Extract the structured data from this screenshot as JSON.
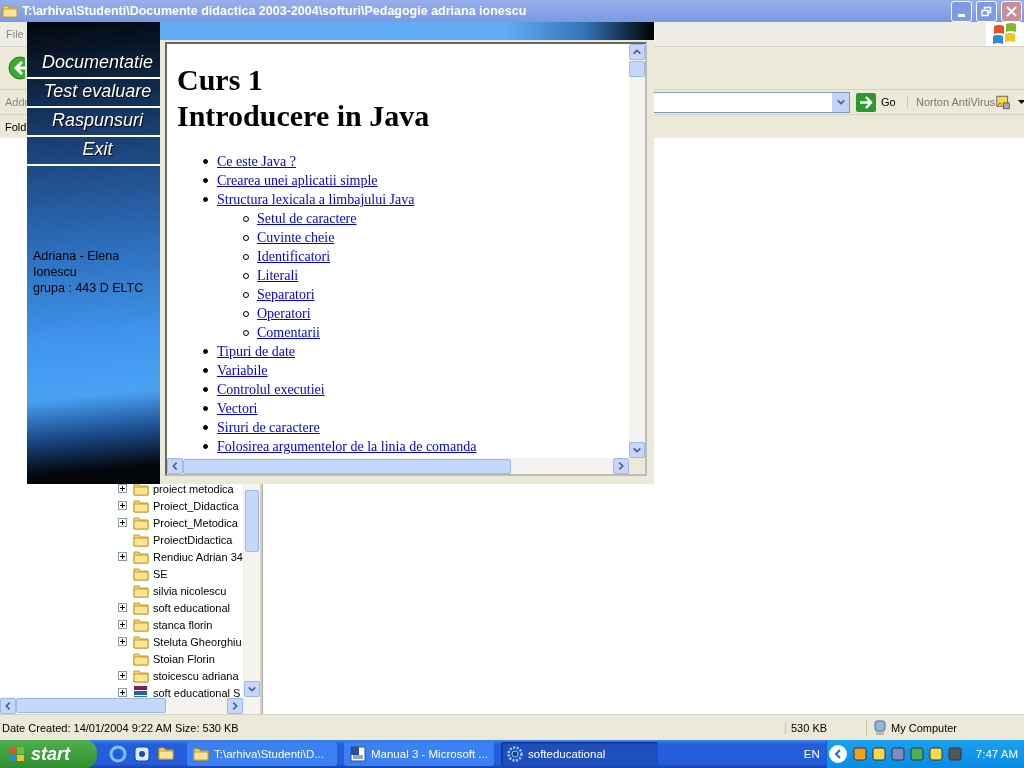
{
  "window": {
    "title": "T:\\arhiva\\Studenti\\Documente didactica 2003-2004\\softuri\\Pedagogie adriana ionescu"
  },
  "menu_bar": {
    "items": [
      "File"
    ]
  },
  "address_bar": {
    "label": "Addr",
    "go_label": "Go",
    "toolbar_label": "Norton AntiVirus"
  },
  "folders_pane": {
    "label": "Fold",
    "tree": [
      {
        "label": "proiect metodica",
        "expandable": true,
        "kind": "folder"
      },
      {
        "label": "Proiect_Didactica",
        "expandable": true,
        "kind": "folder"
      },
      {
        "label": "Proiect_Metodica",
        "expandable": true,
        "kind": "folder"
      },
      {
        "label": "ProiectDidactica",
        "expandable": false,
        "kind": "folder"
      },
      {
        "label": "Rendiuc Adrian 34",
        "expandable": true,
        "kind": "folder"
      },
      {
        "label": "SE",
        "expandable": false,
        "kind": "folder"
      },
      {
        "label": "silvia nicolescu",
        "expandable": false,
        "kind": "folder"
      },
      {
        "label": "soft educational",
        "expandable": true,
        "kind": "folder"
      },
      {
        "label": "stanca florin",
        "expandable": true,
        "kind": "folder"
      },
      {
        "label": "Steluta Gheorghiu",
        "expandable": true,
        "kind": "folder"
      },
      {
        "label": "Stoian Florin",
        "expandable": false,
        "kind": "folder"
      },
      {
        "label": "stoicescu adriana",
        "expandable": true,
        "kind": "folder"
      },
      {
        "label": "soft educational S",
        "expandable": true,
        "kind": "archive"
      }
    ]
  },
  "app_window": {
    "nav": [
      "Documentatie",
      "Test evaluare",
      "Raspunsuri",
      "Exit"
    ],
    "author": "Adriana - Elena Ionescu",
    "group": "grupa : 443 D ELTC",
    "document": {
      "title_lines": [
        "Curs 1",
        "Introducere in Java"
      ],
      "toc": [
        {
          "label": "Ce este Java ?"
        },
        {
          "label": "Crearea unei aplicatii simple"
        },
        {
          "label": "Structura lexicala a limbajului Java",
          "children": [
            {
              "label": "Setul de caractere"
            },
            {
              "label": "Cuvinte cheie"
            },
            {
              "label": "Identificatori"
            },
            {
              "label": "Literali"
            },
            {
              "label": "Separatori"
            },
            {
              "label": "Operatori"
            },
            {
              "label": "Comentarii"
            }
          ]
        },
        {
          "label": "Tipuri de date"
        },
        {
          "label": "Variabile"
        },
        {
          "label": "Controlul executiei"
        },
        {
          "label": "Vectori"
        },
        {
          "label": "Siruri de caractere"
        },
        {
          "label": "Folosirea argumentelor de la linia de comanda"
        }
      ]
    }
  },
  "status_bar": {
    "text": "Date Created: 14/01/2004 9:22 AM Size: 530 KB",
    "size": "530 KB",
    "zone": "My Computer"
  },
  "taskbar": {
    "start_label": "start",
    "tasks": [
      {
        "label": "T:\\arhiva\\Studenti\\D...",
        "kind": "folder",
        "selected": false
      },
      {
        "label": "Manual 3 - Microsoft ...",
        "kind": "document",
        "selected": false
      },
      {
        "label": "softeducational",
        "kind": "gear",
        "selected": true
      }
    ],
    "language": "EN",
    "clock": "7:47 AM"
  }
}
